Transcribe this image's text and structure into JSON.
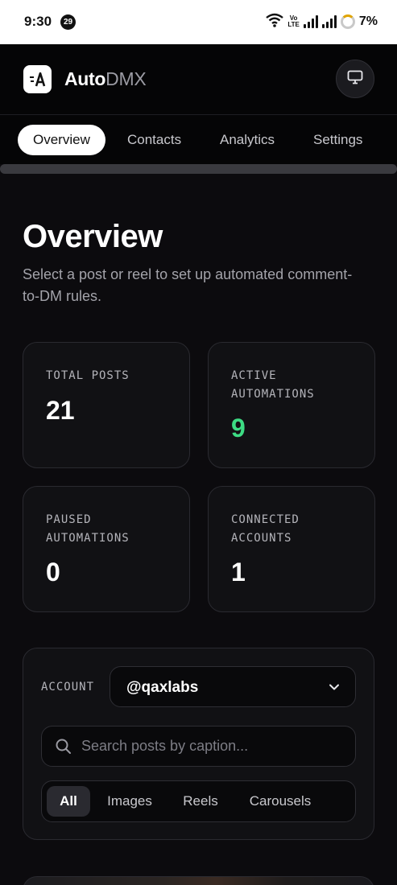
{
  "status_bar": {
    "time": "9:30",
    "notification_count": "29",
    "volte_top": "Vo",
    "volte_bottom": "LTE",
    "battery": "7%"
  },
  "header": {
    "brand_primary": "Auto",
    "brand_secondary": "DMX",
    "icons": [
      "logo-icon",
      "monitor-icon"
    ]
  },
  "tabs": [
    {
      "label": "Overview",
      "active": true
    },
    {
      "label": "Contacts",
      "active": false
    },
    {
      "label": "Analytics",
      "active": false
    },
    {
      "label": "Settings",
      "active": false
    }
  ],
  "main": {
    "title": "Overview",
    "subtitle": "Select a post or reel to set up automated comment-to-DM rules."
  },
  "stats": [
    {
      "label": "TOTAL POSTS",
      "value": "21",
      "color": "#ffffff"
    },
    {
      "label": "ACTIVE AUTOMATIONS",
      "value": "9",
      "color": "#3ddc84"
    },
    {
      "label": "PAUSED AUTOMATIONS",
      "value": "0",
      "color": "#ffffff"
    },
    {
      "label": "CONNECTED ACCOUNTS",
      "value": "1",
      "color": "#ffffff"
    }
  ],
  "filters": {
    "account_label": "ACCOUNT",
    "account_value": "@qaxlabs",
    "search_placeholder": "Search posts by caption...",
    "search_value": "",
    "segments": [
      {
        "label": "All",
        "active": true
      },
      {
        "label": "Images",
        "active": false
      },
      {
        "label": "Reels",
        "active": false
      },
      {
        "label": "Carousels",
        "active": false
      }
    ]
  },
  "colors": {
    "background": "#0c0b0e",
    "card": "#111114",
    "accent_green": "#3ddc84"
  }
}
